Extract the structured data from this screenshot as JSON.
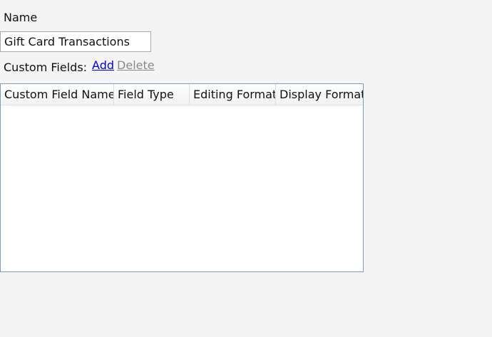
{
  "form": {
    "name_label": "Name",
    "name_value": "Gift Card Transactions",
    "custom_fields_label": "Custom Fields:",
    "add_link": "Add",
    "delete_link": "Delete"
  },
  "grid": {
    "columns": [
      "Custom Field Name",
      "Field Type",
      "Editing Format",
      "Display Format"
    ],
    "rows": []
  }
}
